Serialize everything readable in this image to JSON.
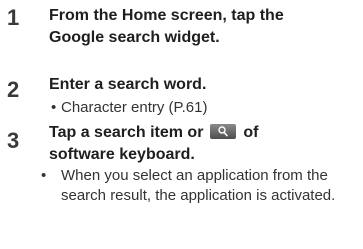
{
  "steps": [
    {
      "number": "1",
      "title_line1": "From the Home screen, tap the",
      "title_line2": "Google search widget."
    },
    {
      "number": "2",
      "title": "Enter a search word.",
      "bullet": "Character entry (P.61)"
    },
    {
      "number": "3",
      "title_before_icon": "Tap a search item or",
      "icon": "search-key-icon",
      "title_after_icon": "of",
      "title_line2": "software keyboard.",
      "bullet": "When you select an application from the search result, the application is activated."
    }
  ],
  "bullet_glyph": "•"
}
